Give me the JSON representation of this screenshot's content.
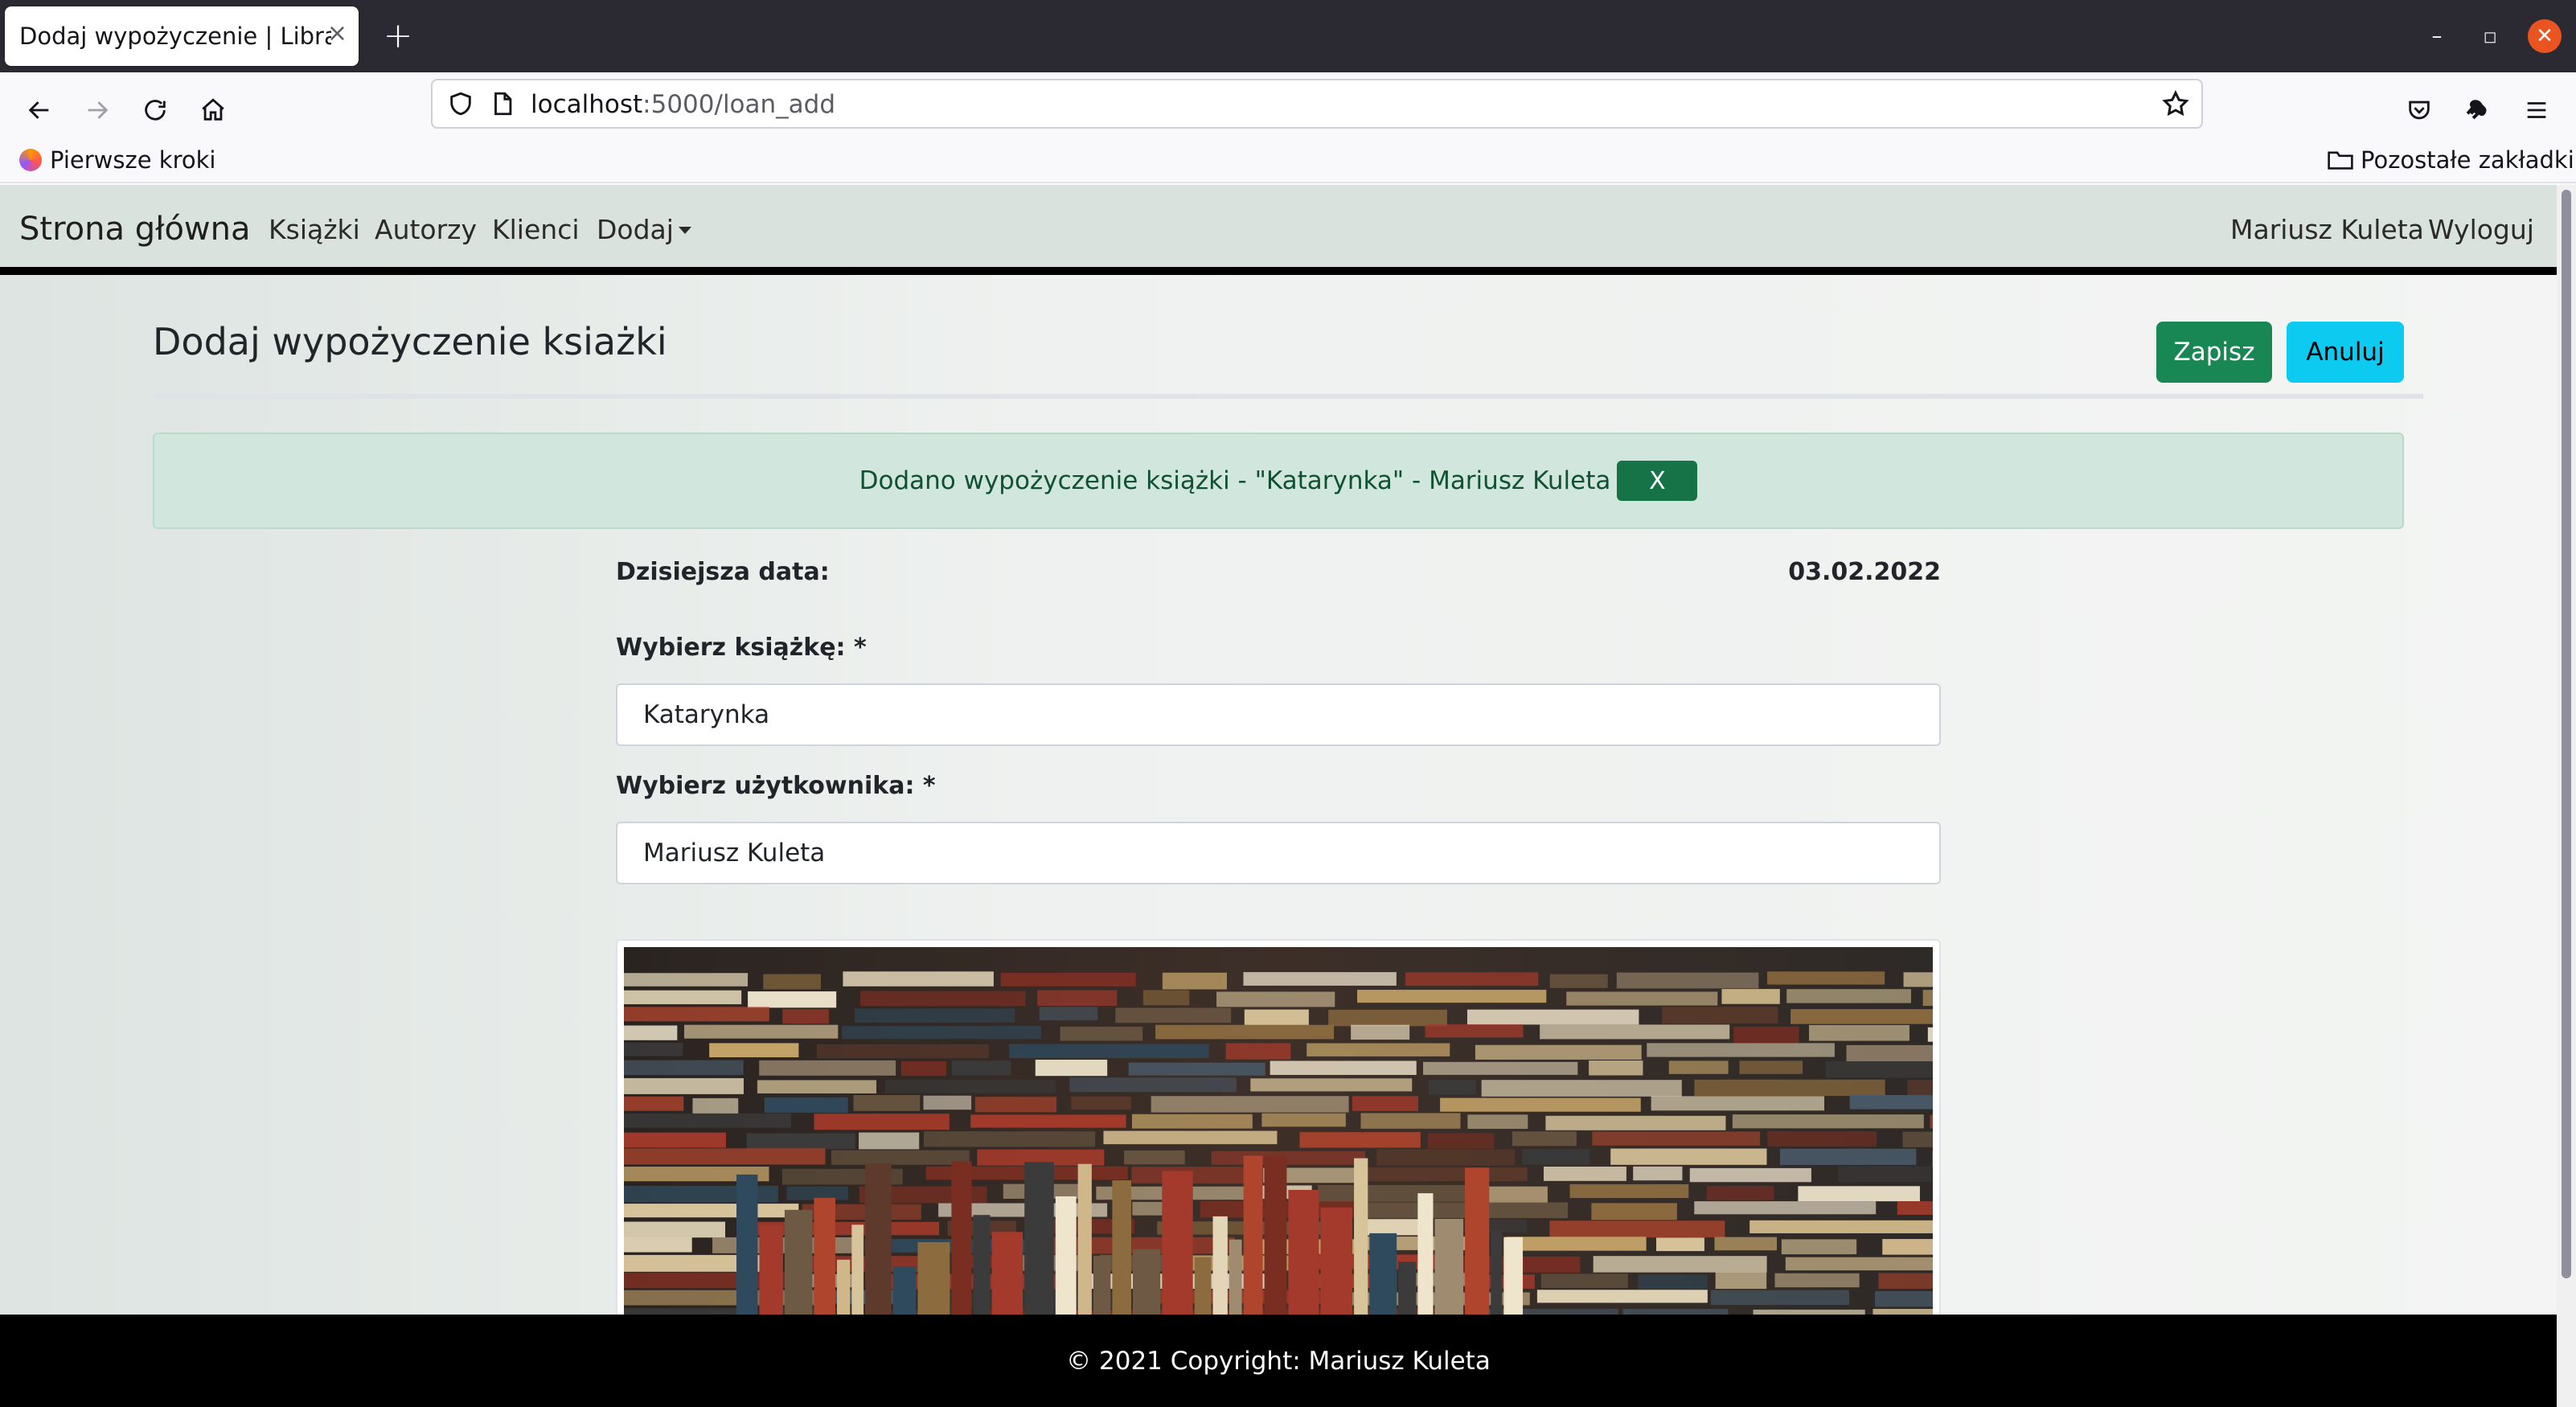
{
  "browser": {
    "tab_title": "Dodaj wypożyczenie | Library",
    "tab_close": "×",
    "new_tab": "+",
    "url_host": "localhost",
    "url_path": ":5000/loan_add",
    "bookmarks": {
      "left_item": "Pierwsze kroki",
      "right_item": "Pozostałe zakładki"
    },
    "window_controls": {
      "minimize": "–",
      "maximize": "◻",
      "close": "✕"
    }
  },
  "site_nav": {
    "brand": "Strona główna",
    "links": [
      "Książki",
      "Autorzy",
      "Klienci",
      "Dodaj"
    ],
    "user": "Mariusz Kuleta",
    "logout": "Wyloguj",
    "background": "#d9e2dd"
  },
  "page": {
    "title": "Dodaj wypożyczenie ksiażki",
    "save_label": "Zapisz",
    "cancel_label": "Anuluj"
  },
  "alert": {
    "text": "Dodano wypożyczenie książki - \"Katarynka\" - Mariusz Kuleta",
    "close_label": "X"
  },
  "form": {
    "date_label": "Dzisiejsza data:",
    "date_value": "03.02.2022",
    "book_label": "Wybierz książkę: *",
    "book_value": "Katarynka",
    "user_label": "Wybierz użytkownika: *",
    "user_value": "Mariusz Kuleta"
  },
  "footer": {
    "text": "© 2021 Copyright: Mariusz Kuleta"
  },
  "colors": {
    "save_button": "#198754",
    "cancel_button": "#0dcaf0",
    "alert_bg": "#d1e7dd",
    "alert_text": "#0f5132",
    "footer_bg": "#000000"
  },
  "icons": [
    "back-arrow-icon",
    "forward-arrow-icon",
    "reload-icon",
    "home-icon",
    "shield-icon",
    "page-icon",
    "bookmark-star-icon",
    "pocket-icon",
    "extension-icon",
    "menu-icon",
    "folder-icon",
    "books-photo"
  ]
}
